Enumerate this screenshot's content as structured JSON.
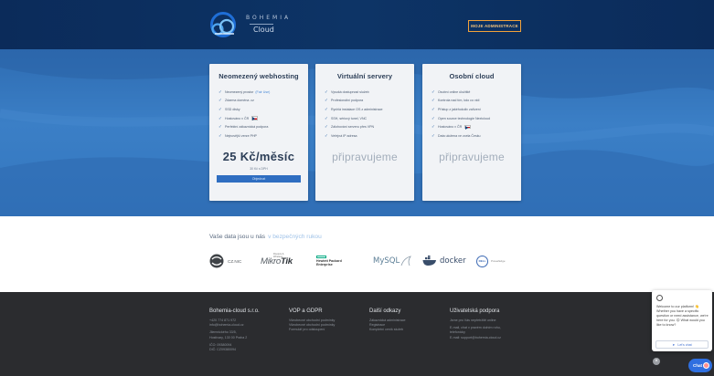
{
  "header": {
    "logo_name": "BOHEMIA",
    "logo_sub": "Cloud",
    "admin_button": "MOJE ADMINISTRACE"
  },
  "plans": [
    {
      "title": "Neomezený webhosting",
      "features": [
        {
          "text": "Neomezený prostor",
          "highlight": "(Fair Use)"
        },
        {
          "text": "Zdarma doména .cz",
          "highlight": ""
        },
        {
          "text": "SSD disky",
          "highlight": ""
        },
        {
          "text": "Hostováno v ČR",
          "highlight": "",
          "flag": true
        },
        {
          "text": "Perfektní zákaznická podpora",
          "highlight": ""
        },
        {
          "text": "Nejnovější verze PHP",
          "highlight": ""
        }
      ],
      "price": "25 Kč/měsíc",
      "vat": "30 Kč s DPH",
      "button": "Objednat"
    },
    {
      "title": "Virtuální servery",
      "features": [
        {
          "text": "Vysoká dostupnost služeb",
          "highlight": ""
        },
        {
          "text": "Profesionální podpora",
          "highlight": ""
        },
        {
          "text": "Rychlá instalace OS z administrace",
          "highlight": ""
        },
        {
          "text": "SSH, sériový tunel, VNC",
          "highlight": ""
        },
        {
          "text": "Zálohování serveru přes VPN",
          "highlight": ""
        },
        {
          "text": "Veřejná IP adresa",
          "highlight": ""
        }
      ],
      "soon": "připravujeme"
    },
    {
      "title": "Osobní cloud",
      "features": [
        {
          "text": "Osobní online úložiště",
          "highlight": ""
        },
        {
          "text": "Kontrola nad tím, kdo co vidí",
          "highlight": ""
        },
        {
          "text": "Přístup z jakéhokoliv zařízení",
          "highlight": ""
        },
        {
          "text": "Open source technologie Nextcloud",
          "highlight": ""
        },
        {
          "text": "Hostováno v ČR",
          "highlight": "",
          "flag": true
        },
        {
          "text": "Data uložena ve zcela Česku",
          "highlight": ""
        }
      ],
      "soon": "připravujeme"
    }
  ],
  "partners": {
    "heading": "Vaše data jsou u nás",
    "heading_highlight": "v bezpečných rukou",
    "logos": {
      "cz_nic": "CZ.NIC",
      "mikrotik_small": "Routers & Wireless",
      "mikrotik_a": "Mikro",
      "mikrotik_b": "Tik",
      "hpe_1": "Hewlett Packard",
      "hpe_2": "Enterprise",
      "mysql": "MySQL",
      "docker": "docker",
      "dell_mark": "DELL",
      "dell_text": "PowerEdge"
    }
  },
  "footer": {
    "col1": {
      "title": "Bohemia-cloud s.r.o.",
      "lines": [
        "+420 774 871 972",
        "info@bohemia-cloud.cz",
        "Jilemnického 33/5,",
        "Hostivary, 130 00 Praha 2",
        "IČO: 09380094",
        "DIČ: CZ09380094"
      ]
    },
    "col2": {
      "title": "VOP a GDPR",
      "lines": [
        "Všeobecné obchodní podmínky",
        "Všeobecné obchodní podmínky",
        "Formulář pro odstoupení"
      ]
    },
    "col3": {
      "title": "Další odkazy",
      "lines": [
        "Zákaznická administrace",
        "Registrace",
        "Kompletní ceník služeb"
      ]
    },
    "col4": {
      "title": "Uživatelská podpora",
      "lines": [
        "Jsme pro Vás nepřetržitě online",
        "E-mail, chat v pravém dolním rohu,",
        "telefonicky",
        "E-mail: support@bohemia-cloud.cz"
      ]
    }
  },
  "chat": {
    "message": "Welcome to our platform! 👋 Whether you have a specific question or need assistance, we're here for you. 😊 What would you like to know?",
    "start_button": "Let's chat",
    "chat_label": "Chat"
  }
}
